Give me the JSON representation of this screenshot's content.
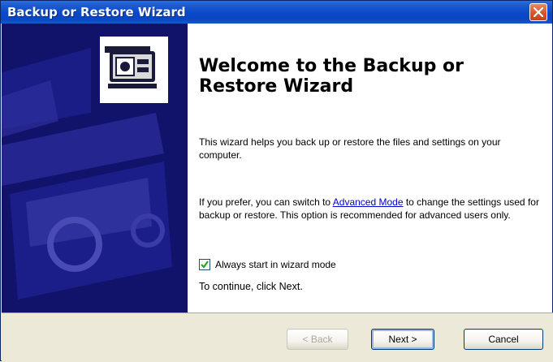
{
  "window": {
    "title": "Backup or Restore Wizard"
  },
  "icons": {
    "close": "close-icon",
    "wizard_logo": "backup-wizard-icon",
    "checkbox_check": "checkmark-icon"
  },
  "colors": {
    "titlebar": "#0a48c8",
    "left_panel": "#11126a",
    "link": "#0000cc",
    "close_button": "#d5502a"
  },
  "content": {
    "heading": "Welcome to the Backup or Restore Wizard",
    "intro": "This wizard helps you back up or restore the files and settings on your computer.",
    "advanced_before": "If you prefer, you can switch to ",
    "advanced_link": "Advanced Mode",
    "advanced_after": " to change the settings used for backup or restore. This option is recommended for advanced users only.",
    "checkbox_label": "Always start in wizard mode",
    "checkbox_checked": true,
    "continue_text": "To continue, click Next."
  },
  "buttons": {
    "back": "< Back",
    "next": "Next >",
    "cancel": "Cancel"
  }
}
